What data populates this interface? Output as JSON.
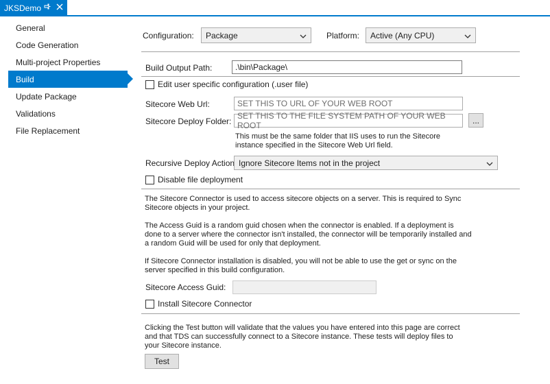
{
  "tab": {
    "title": "JKSDemo",
    "pin_icon": "pin-icon",
    "close_icon": "close-icon"
  },
  "sidebar": {
    "items": [
      {
        "label": "General"
      },
      {
        "label": "Code Generation"
      },
      {
        "label": "Multi-project Properties"
      },
      {
        "label": "Build"
      },
      {
        "label": "Update Package"
      },
      {
        "label": "Validations"
      },
      {
        "label": "File Replacement"
      }
    ],
    "active": "Build"
  },
  "config": {
    "configuration_label": "Configuration:",
    "configuration_value": "Package",
    "platform_label": "Platform:",
    "platform_value": "Active (Any CPU)"
  },
  "build": {
    "output_path_label": "Build Output Path:",
    "output_path_value": ".\\bin\\Package\\",
    "edit_user_config_label": "Edit user specific configuration (.user file)",
    "web_url_label": "Sitecore Web Url:",
    "web_url_placeholder": "SET THIS TO URL OF YOUR WEB ROOT",
    "deploy_folder_label": "Sitecore Deploy Folder:",
    "deploy_folder_placeholder": "SET THIS TO THE FILE SYSTEM PATH OF YOUR WEB ROOT",
    "browse_label": "...",
    "deploy_folder_note_1": "This must be the same folder that IIS uses to run the Sitecore",
    "deploy_folder_note_2": "instance specified in the Sitecore Web Url field.",
    "recursive_label": "Recursive Deploy Action:",
    "recursive_value": "Ignore Sitecore Items not in the project",
    "disable_deploy_label": "Disable file deployment"
  },
  "connector": {
    "para1_line1": "The Sitecore Connector is used to access sitecore objects on a server. This is required to Sync",
    "para1_line2": "Sitecore objects in your project.",
    "para2_line1": "The Access Guid is a random guid chosen when the connector is enabled. If a deployment is",
    "para2_line2": "done to a server where the connector isn't installed, the connector will be temporarily installed and",
    "para2_line3": "a random Guid will be used for only that deployment.",
    "para3_line1": "If Sitecore Connector installation is disabled, you will not be able to use the get or sync on the",
    "para3_line2": "server specified in this build configuration.",
    "access_guid_label": "Sitecore Access Guid:",
    "access_guid_value": "",
    "install_label": "Install Sitecore Connector"
  },
  "test": {
    "line1": "Clicking the Test button will validate that the values you have entered into this page are correct",
    "line2": "and that TDS can successfully connect to a Sitecore instance. These tests will deploy files to",
    "line3": "your Sitecore instance.",
    "button_label": "Test"
  },
  "colors": {
    "accent": "#007acc"
  }
}
